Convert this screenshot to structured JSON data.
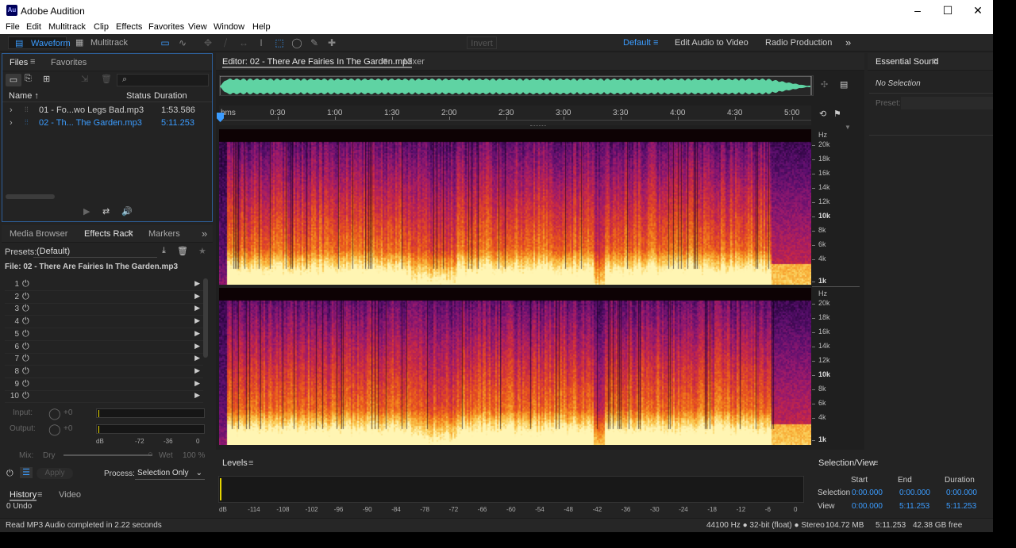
{
  "app": {
    "title": "Adobe Audition",
    "logo": "Au"
  },
  "window_controls": {
    "minimize": "–",
    "maximize": "☐",
    "close": "✕"
  },
  "menu": [
    "File",
    "Edit",
    "Multitrack",
    "Clip",
    "Effects",
    "Favorites",
    "View",
    "Window",
    "Help"
  ],
  "toolbar": {
    "waveform": "Waveform",
    "multitrack": "Multitrack",
    "invert": "Invert",
    "workspaces": [
      "Default",
      "Edit Audio to Video",
      "Radio Production"
    ],
    "more": "»"
  },
  "files_panel": {
    "tabs": [
      "Files",
      "Favorites"
    ],
    "columns": {
      "name": "Name ↑",
      "status": "Status",
      "duration": "Duration"
    },
    "files": [
      {
        "name": "01 - Fo...wo Legs Bad.mp3",
        "duration": "1:53.586"
      },
      {
        "name": "02 - Th... The Garden.mp3",
        "duration": "5:11.253"
      }
    ]
  },
  "effects_panel": {
    "tabs": [
      "Media Browser",
      "Effects Rack",
      "Markers"
    ],
    "presets_label": "Presets:",
    "preset_value": "(Default)",
    "file_label": "File: 02 - There Are Fairies In The Garden.mp3",
    "slots": [
      "1",
      "2",
      "3",
      "4",
      "5",
      "6",
      "7",
      "8",
      "9",
      "10"
    ],
    "input_label": "Input:",
    "output_label": "Output:",
    "gain": "+0",
    "meter_ticks": [
      "dB",
      "-72",
      "-36",
      "0"
    ],
    "mix_label": "Mix:",
    "dry": "Dry",
    "wet": "Wet",
    "wet_pct": "100 %",
    "apply": "Apply",
    "process_label": "Process:",
    "process_value": "Selection Only"
  },
  "history_panel": {
    "tabs": [
      "History",
      "Video"
    ],
    "entry": "0 Undo"
  },
  "status": {
    "message": "Read MP3 Audio completed in 2.22 seconds",
    "format": "44100 Hz ● 32-bit (float) ● Stereo",
    "size": "104.72 MB",
    "duration": "5:11.253",
    "free": "42.38 GB free"
  },
  "editor": {
    "tab": "Editor: 02 - There Are Fairies In The Garden.mp3",
    "mixer": "Mixer",
    "ruler": [
      "hms",
      "0:30",
      "1:00",
      "1:30",
      "2:00",
      "2:30",
      "3:00",
      "3:30",
      "4:00",
      "4:30",
      "5:00"
    ],
    "hz_unit": "Hz",
    "hz_labels": [
      "20k",
      "18k",
      "16k",
      "14k",
      "12k",
      "10k",
      "8k",
      "6k",
      "4k",
      "1k"
    ]
  },
  "levels_panel": {
    "title": "Levels",
    "ticks": [
      "dB",
      "-114",
      "-108",
      "-102",
      "-96",
      "-90",
      "-84",
      "-78",
      "-72",
      "-66",
      "-60",
      "-54",
      "-48",
      "-42",
      "-36",
      "-30",
      "-24",
      "-18",
      "-12",
      "-6",
      "0"
    ]
  },
  "essential_sound": {
    "title": "Essential Sound",
    "selection": "No Selection",
    "preset_label": "Preset:"
  },
  "selection_view": {
    "title": "Selection/View",
    "headers": [
      "Start",
      "End",
      "Duration"
    ],
    "rows": [
      {
        "label": "Selection",
        "start": "0:00.000",
        "end": "0:00.000",
        "duration": "0:00.000"
      },
      {
        "label": "View",
        "start": "0:00.000",
        "end": "5:11.253",
        "duration": "5:11.253"
      }
    ]
  },
  "colors": {
    "accent": "#3b9cff",
    "waveform": "#5fd3a3",
    "bg": "#232323",
    "titlebar": "#ffffff"
  }
}
